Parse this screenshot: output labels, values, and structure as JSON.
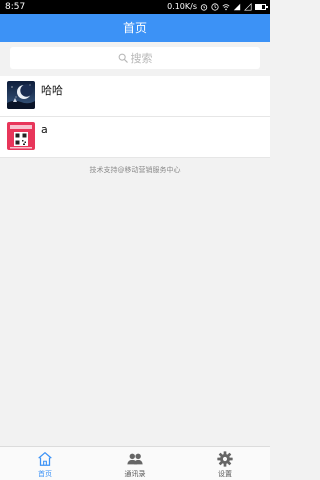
{
  "status_bar": {
    "time": "8:57",
    "net_speed": "0.10K/s"
  },
  "header": {
    "title": "首页"
  },
  "search": {
    "placeholder": "搜索"
  },
  "list": {
    "items": [
      {
        "name": "哈哈",
        "avatar": "night-moon-avatar"
      },
      {
        "name": "a",
        "avatar": "qr-card-avatar"
      }
    ]
  },
  "footer_note": "技术支持@移动营销服务中心",
  "tabbar": {
    "tabs": [
      {
        "label": "首页",
        "icon": "home-icon",
        "active": true
      },
      {
        "label": "通讯录",
        "icon": "contacts-icon",
        "active": false
      },
      {
        "label": "设置",
        "icon": "gear-icon",
        "active": false
      }
    ]
  },
  "colors": {
    "primary": "#3c92f6",
    "background": "#f2f2f2"
  }
}
